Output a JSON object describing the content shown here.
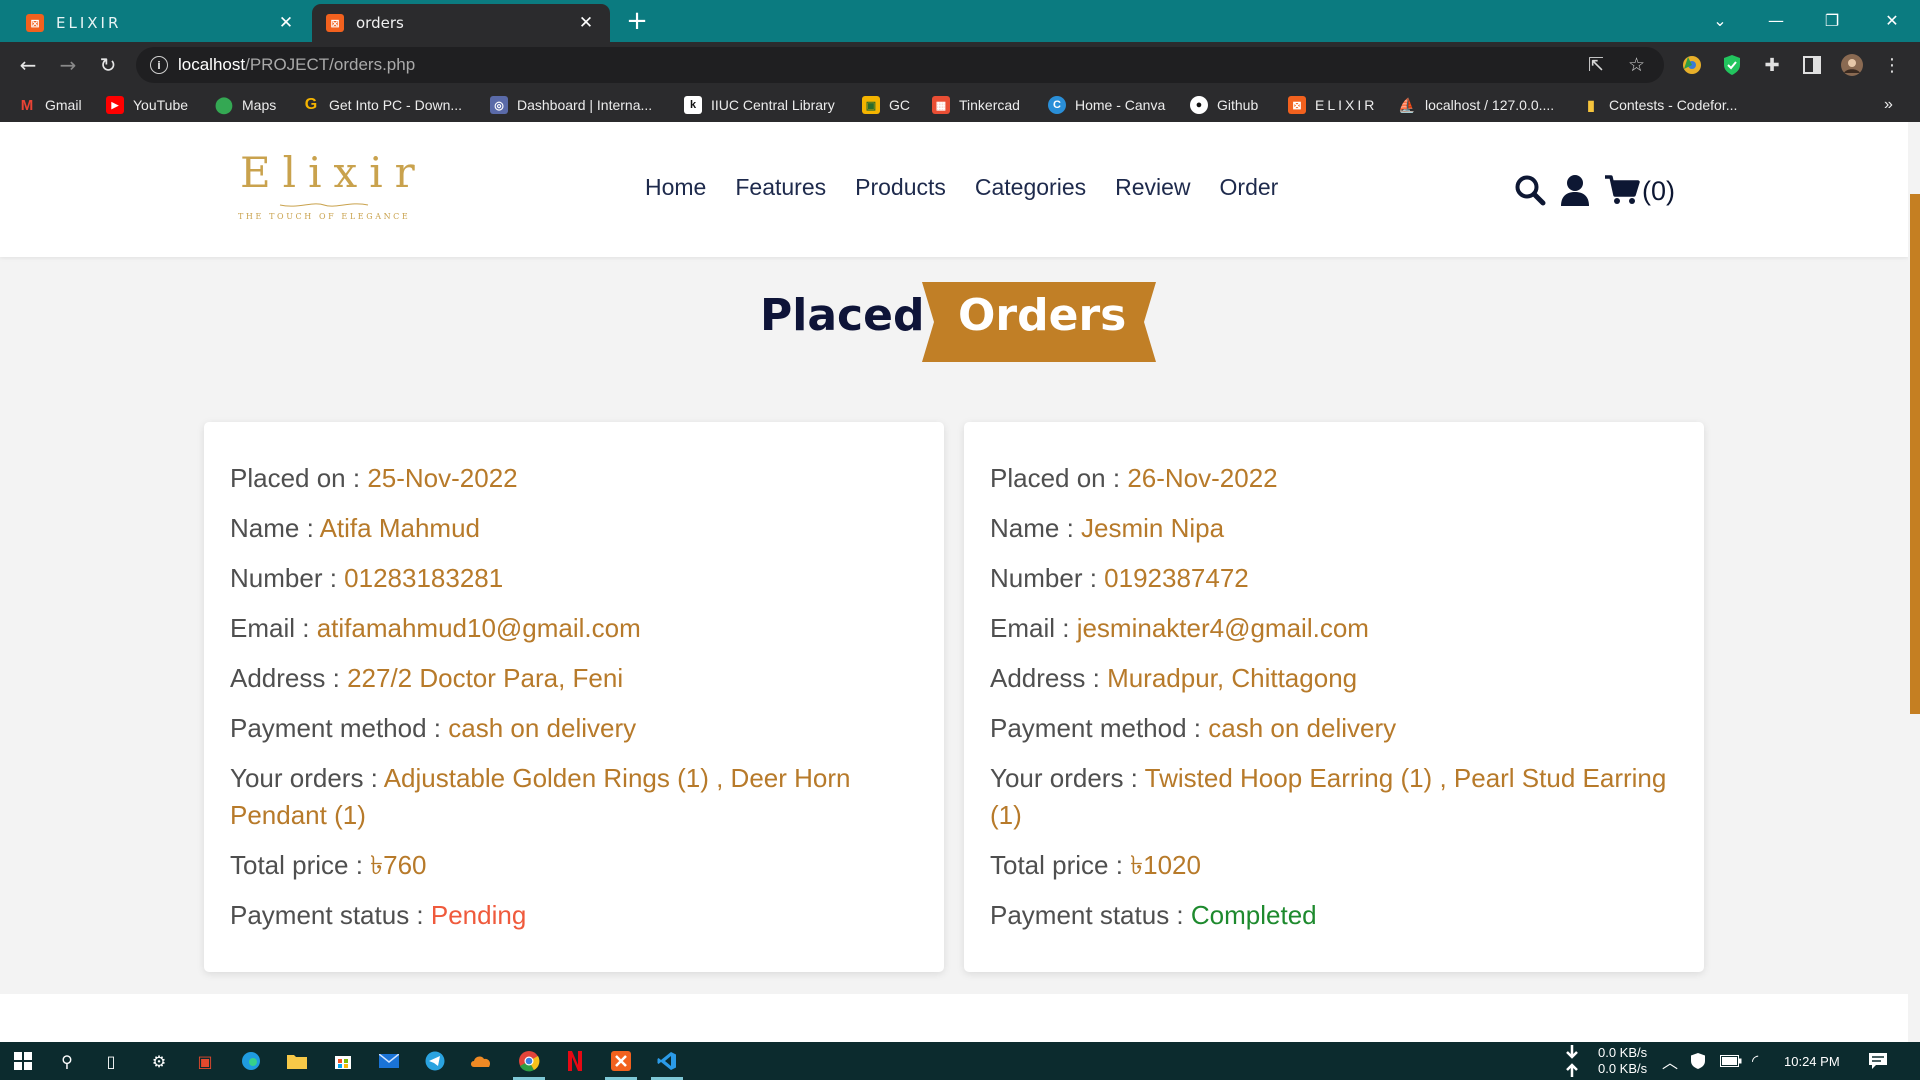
{
  "browser": {
    "tabs": [
      {
        "title": "ELIXIR",
        "active": false
      },
      {
        "title": "orders",
        "active": true
      }
    ],
    "url_host": "localhost",
    "url_path": "/PROJECT/orders.php",
    "bookmarks": [
      {
        "label": "Gmail",
        "icon": "gmail-icon",
        "color": "#ea4335"
      },
      {
        "label": "YouTube",
        "icon": "youtube-icon",
        "color": "#ff0000"
      },
      {
        "label": "Maps",
        "icon": "maps-icon",
        "color": "#34a853"
      },
      {
        "label": "Get Into PC - Down...",
        "icon": "getintopc-icon",
        "color": "#f5b400"
      },
      {
        "label": "Dashboard | Interna...",
        "icon": "dashboard-icon",
        "color": "#9aa3c7"
      },
      {
        "label": "IIUC Central Library",
        "icon": "library-icon",
        "color": "#ffffff"
      },
      {
        "label": "GC",
        "icon": "classroom-icon",
        "color": "#f4b400"
      },
      {
        "label": "Tinkercad",
        "icon": "tinkercad-icon",
        "color": "#e94e34"
      },
      {
        "label": "Home - Canva",
        "icon": "canva-icon",
        "color": "#2a8fd8"
      },
      {
        "label": "Github",
        "icon": "github-icon",
        "color": "#ffffff"
      },
      {
        "label": "ELIXIR",
        "icon": "xampp-icon",
        "color": "#f2611e"
      },
      {
        "label": "localhost / 127.0.0....",
        "icon": "phpmyadmin-icon",
        "color": "#f29111"
      },
      {
        "label": "Contests - Codefor...",
        "icon": "codeforces-icon",
        "color": "#f6c43c"
      }
    ]
  },
  "site": {
    "logo_text": "Elixir",
    "logo_tagline": "THE TOUCH OF ELEGANCE",
    "nav": [
      "Home",
      "Features",
      "Products",
      "Categories",
      "Review",
      "Order"
    ],
    "cart_count": "(0)"
  },
  "heading": {
    "part1": "Placed",
    "part2": "Orders"
  },
  "labels": {
    "placed_on": "Placed on : ",
    "name": "Name : ",
    "number": "Number : ",
    "email": "Email : ",
    "address": "Address : ",
    "payment_method": "Payment method : ",
    "your_orders": "Your orders : ",
    "total_price": "Total price : ",
    "payment_status": "Payment status : "
  },
  "orders": [
    {
      "placed_on": "25-Nov-2022",
      "name": "Atifa Mahmud",
      "number": "01283183281",
      "email": "atifamahmud10@gmail.com",
      "address": "227/2 Doctor Para, Feni",
      "payment_method": "cash on delivery",
      "your_orders": "Adjustable Golden Rings (1) , Deer Horn Pendant (1)",
      "total_price": "৳760",
      "payment_status": "Pending"
    },
    {
      "placed_on": "26-Nov-2022",
      "name": "Jesmin Nipa",
      "number": "0192387472",
      "email": "jesminakter4@gmail.com",
      "address": "Muradpur, Chittagong",
      "payment_method": "cash on delivery",
      "your_orders": "Twisted Hoop Earring (1) , Pearl Stud Earring (1)",
      "total_price": "৳1020",
      "payment_status": "Completed"
    }
  ],
  "taskbar": {
    "net_down": "0.0 KB/s",
    "net_up": "0.0 KB/s",
    "time": "10:24 PM"
  },
  "colors": {
    "accent": "#b77a2a",
    "ribbon": "#c17f26",
    "navy": "#0e1438",
    "pending": "#ef5a3c",
    "completed": "#1e8a2e",
    "tabstrip": "#0b7b80"
  }
}
